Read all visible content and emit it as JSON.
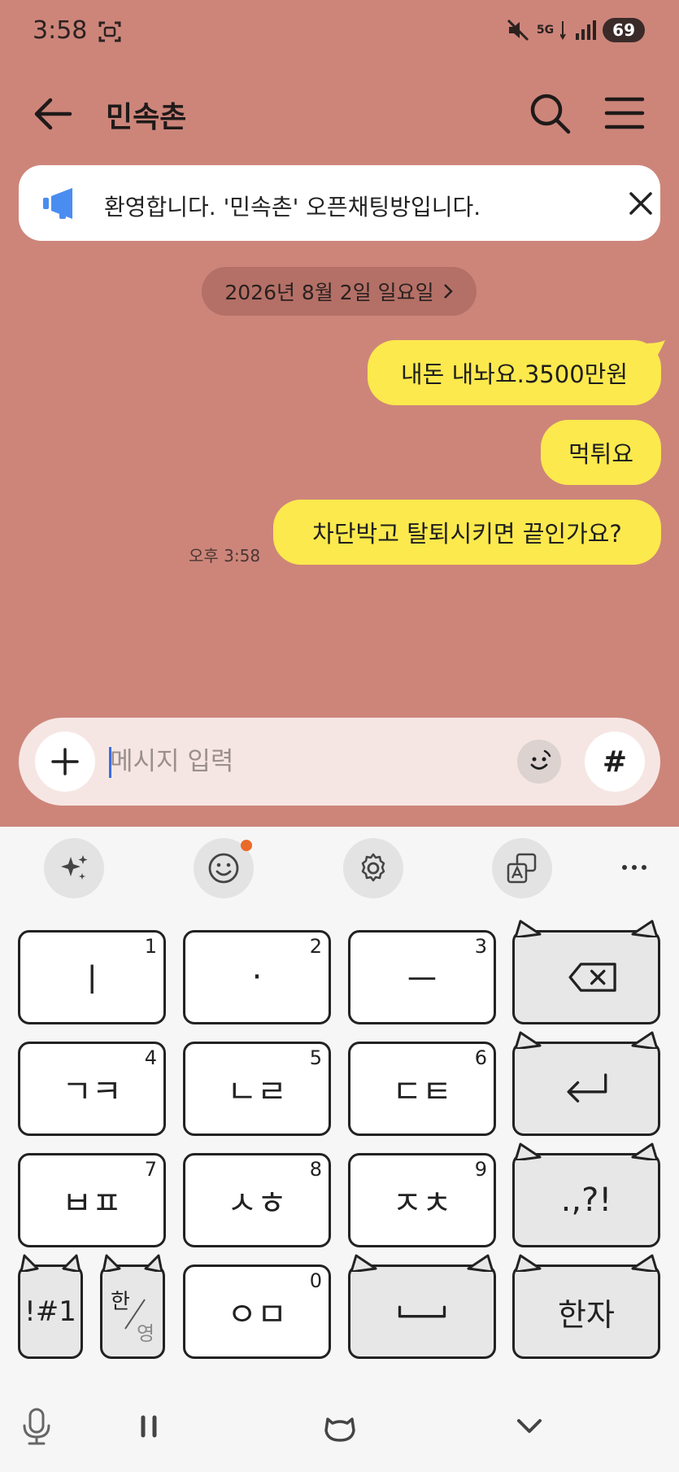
{
  "status_bar": {
    "time": "3:58",
    "network": "5G",
    "battery": "69"
  },
  "header": {
    "title": "민속촌"
  },
  "notice": {
    "text": "환영합니다. '민속촌' 오픈채팅방입니다."
  },
  "date_divider": {
    "label": "2026년 8월 2일 일요일"
  },
  "messages": [
    {
      "text": "내돈 내놔요.3500만원",
      "sender": "me"
    },
    {
      "text": "먹튀요",
      "sender": "me"
    },
    {
      "text": "차단박고 탈퇴시키면 끝인가요?",
      "sender": "me",
      "time": "오후 3:58"
    }
  ],
  "composer": {
    "placeholder": "메시지 입력",
    "value": "",
    "hash_label": "#"
  },
  "keyboard": {
    "keys": [
      {
        "name": "key-1",
        "label": "ㅣ",
        "num": "1"
      },
      {
        "name": "key-2",
        "label": "·",
        "num": "2"
      },
      {
        "name": "key-3",
        "label": "ㅡ",
        "num": "3"
      },
      {
        "name": "key-4",
        "label": "ㄱㅋ",
        "num": "4"
      },
      {
        "name": "key-5",
        "label": "ㄴㄹ",
        "num": "5"
      },
      {
        "name": "key-6",
        "label": "ㄷㅌ",
        "num": "6"
      },
      {
        "name": "key-7",
        "label": "ㅂㅍ",
        "num": "7"
      },
      {
        "name": "key-8",
        "label": "ㅅㅎ",
        "num": "8"
      },
      {
        "name": "key-9",
        "label": "ㅈㅊ",
        "num": "9"
      },
      {
        "name": "key-0",
        "label": "ㅇㅁ",
        "num": "0"
      }
    ],
    "punct_label": ".,?!",
    "symbols_label": "!#1",
    "lang_top": "한",
    "lang_bottom": "영",
    "hanja_label": "한자"
  },
  "colors": {
    "chat_bg": "#cd857a",
    "my_bubble": "#fce94d",
    "notice_icon": "#4a8df0",
    "notif_dot": "#ea6a2a"
  }
}
